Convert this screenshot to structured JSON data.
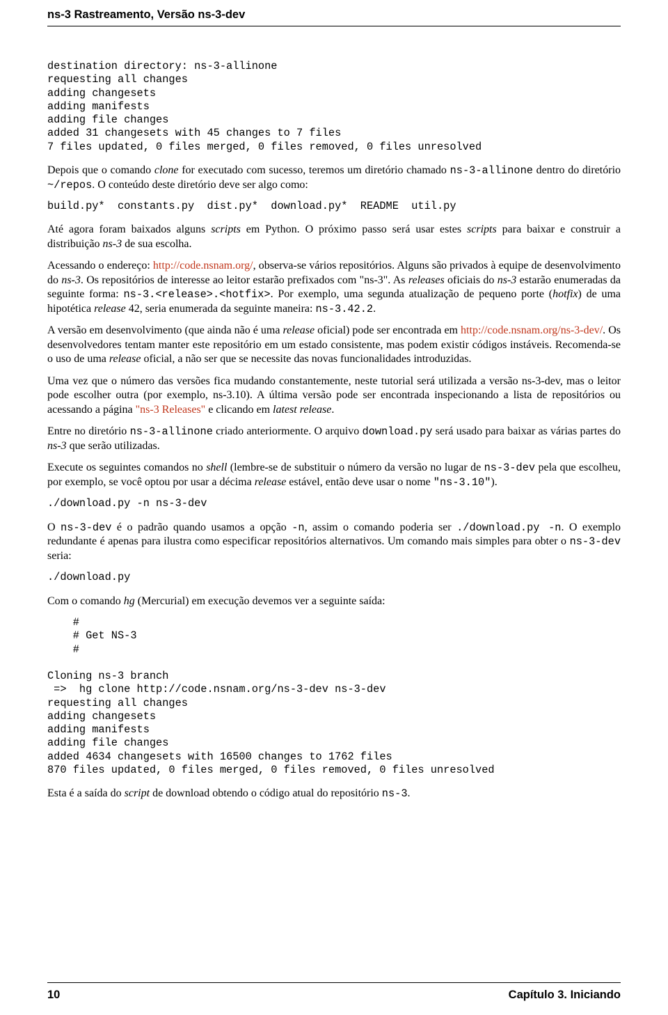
{
  "header_title": "ns-3 Rastreamento, Versão ns-3-dev",
  "code1": "destination directory: ns-3-allinone\nrequesting all changes\nadding changesets\nadding manifests\nadding file changes\nadded 31 changesets with 45 changes to 7 files\n7 files updated, 0 files merged, 0 files removed, 0 files unresolved",
  "p1_a": "Depois que o comando ",
  "p1_b": " for executado com sucesso, teremos um diretório chamado ",
  "p1_c": " dentro do diretório ",
  "p1_d": ". O conteúdo deste diretório deve ser algo como:",
  "p1_clone": "clone",
  "p1_allinone": "ns-3-allinone",
  "p1_repos": "~/repos",
  "code2": "build.py*  constants.py  dist.py*  download.py*  README  util.py",
  "p2_a": "Até agora foram baixados alguns ",
  "p2_scripts": "scripts",
  "p2_b": " em Python. O próximo passo será usar estes ",
  "p2_c": " para baixar e construir a distribuição ",
  "p2_ns3": "ns-3",
  "p2_d": " de sua escolha.",
  "p3_a": "Acessando o endereço: ",
  "p3_link1": "http://code.nsnam.org/",
  "p3_b": ", observa-se vários repositórios. Alguns são privados à equipe de desenvolvimento do ",
  "p3_c": ". Os repositórios de interesse ao leitor estarão prefixados com \"ns-3\". As ",
  "p3_rel": "releases",
  "p3_d": " oficiais do ",
  "p3_e": " estarão enumeradas da seguinte forma: ",
  "p3_code1": "ns-3.<release>.<hotfix>",
  "p3_f": ". Por exemplo, uma segunda atualização de pequeno porte (",
  "p3_hotfix": "hotfix",
  "p3_g": ") de uma hipotética ",
  "p3_release": "release",
  "p3_h": " 42, seria enumerada da seguinte maneira: ",
  "p3_code2": "ns-3.42.2",
  "p3_i": ".",
  "p4_a": "A versão em desenvolvimento (que ainda não é uma ",
  "p4_b": " oficial) pode ser encontrada em ",
  "p4_link": "http://code.nsnam.org/ns-3-dev/",
  "p4_c": ". Os desenvolvedores tentam manter este repositório em um estado consistente, mas podem existir códigos instáveis. Recomenda-se o uso de uma ",
  "p4_d": " oficial, a não ser que se necessite das novas funcionalidades introduzidas.",
  "p5_a": "Uma vez que o número das versões fica mudando constantemente, neste tutorial será utilizada a versão ns-3-dev, mas o leitor pode escolher outra (por exemplo, ns-3.10). A última versão pode ser encontrada inspecionando a lista de repositórios ou acessando a página ",
  "p5_link": "\"ns-3 Releases\"",
  "p5_b": " e clicando em ",
  "p5_latest": "latest release",
  "p5_c": ".",
  "p6_a": "Entre no diretório ",
  "p6_allinone": "ns-3-allinone",
  "p6_b": " criado anteriormente.  O arquivo ",
  "p6_download": "download.py",
  "p6_c": " será usado para baixar as várias partes do ",
  "p6_d": " que serão utilizadas.",
  "p7_a": "Execute os seguintes comandos no ",
  "p7_shell": "shell",
  "p7_b": " (lembre-se de substituir o número da versão no lugar de ",
  "p7_dev": "ns-3-dev",
  "p7_c": " pela que escolheu, por exemplo, se você optou por usar a décima ",
  "p7_d": " estável, então deve usar o nome ",
  "p7_code": "\"ns-3.10\"",
  "p7_e": ").",
  "code3": "./download.py -n ns-3-dev",
  "p8_a": "O ",
  "p8_dev": "ns-3-dev",
  "p8_b": " é o padrão quando usamos a opção ",
  "p8_n": "-n",
  "p8_c": ", assim o comando poderia ser ",
  "p8_cmd": "./download.py -n",
  "p8_d": ".  O exemplo redundante é apenas para ilustra como especificar repositórios alternativos. Um comando mais simples para obter o ",
  "p8_e": " seria:",
  "code4": "./download.py",
  "p9_a": "Com o comando ",
  "p9_hg": "hg",
  "p9_b": " (Mercurial) em execução devemos ver a seguinte saída:",
  "code5": "    #\n    # Get NS-3\n    #\n\nCloning ns-3 branch\n =>  hg clone http://code.nsnam.org/ns-3-dev ns-3-dev\nrequesting all changes\nadding changesets\nadding manifests\nadding file changes\nadded 4634 changesets with 16500 changes to 1762 files\n870 files updated, 0 files merged, 0 files removed, 0 files unresolved",
  "p10_a": "Esta é a saída do ",
  "p10_script": "script",
  "p10_b": " de download obtendo o código atual do repositório ",
  "p10_ns3": "ns-3",
  "p10_c": ".",
  "footer_page": "10",
  "footer_chapter": "Capítulo 3.  Iniciando"
}
